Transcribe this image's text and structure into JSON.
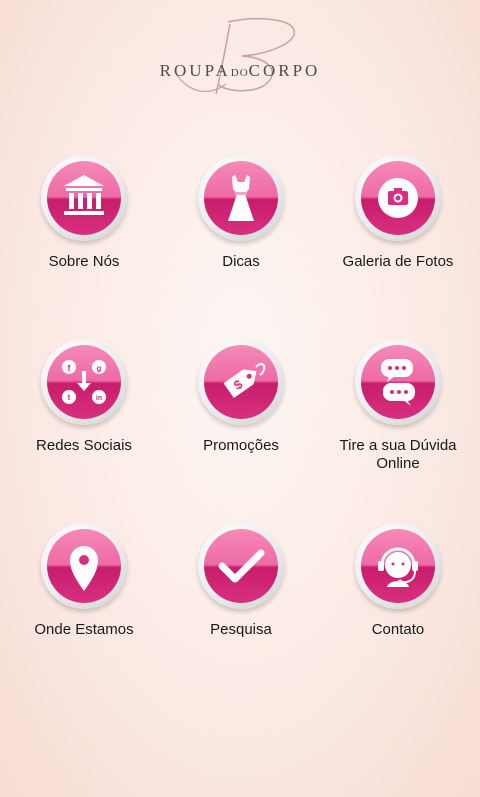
{
  "brand": {
    "logo_text": "ROUPA",
    "logo_small": "DO",
    "logo_text2": "CORPO"
  },
  "menu": {
    "items": [
      {
        "label": "Sobre Nós",
        "icon": "building-icon"
      },
      {
        "label": "Dicas",
        "icon": "dress-icon"
      },
      {
        "label": "Galeria de Fotos",
        "icon": "camera-icon"
      },
      {
        "label": "Redes Sociais",
        "icon": "social-network-icon"
      },
      {
        "label": "Promoções",
        "icon": "price-tag-icon"
      },
      {
        "label": "Tire a sua Dúvida Online",
        "icon": "chat-bubbles-icon"
      },
      {
        "label": "Onde Estamos",
        "icon": "map-pin-icon"
      },
      {
        "label": "Pesquisa",
        "icon": "checkmark-icon"
      },
      {
        "label": "Contato",
        "icon": "headset-icon"
      }
    ]
  },
  "colors": {
    "accent": "#d8307f",
    "accent_light": "#f58ab9",
    "background": "#fbe9e3"
  }
}
